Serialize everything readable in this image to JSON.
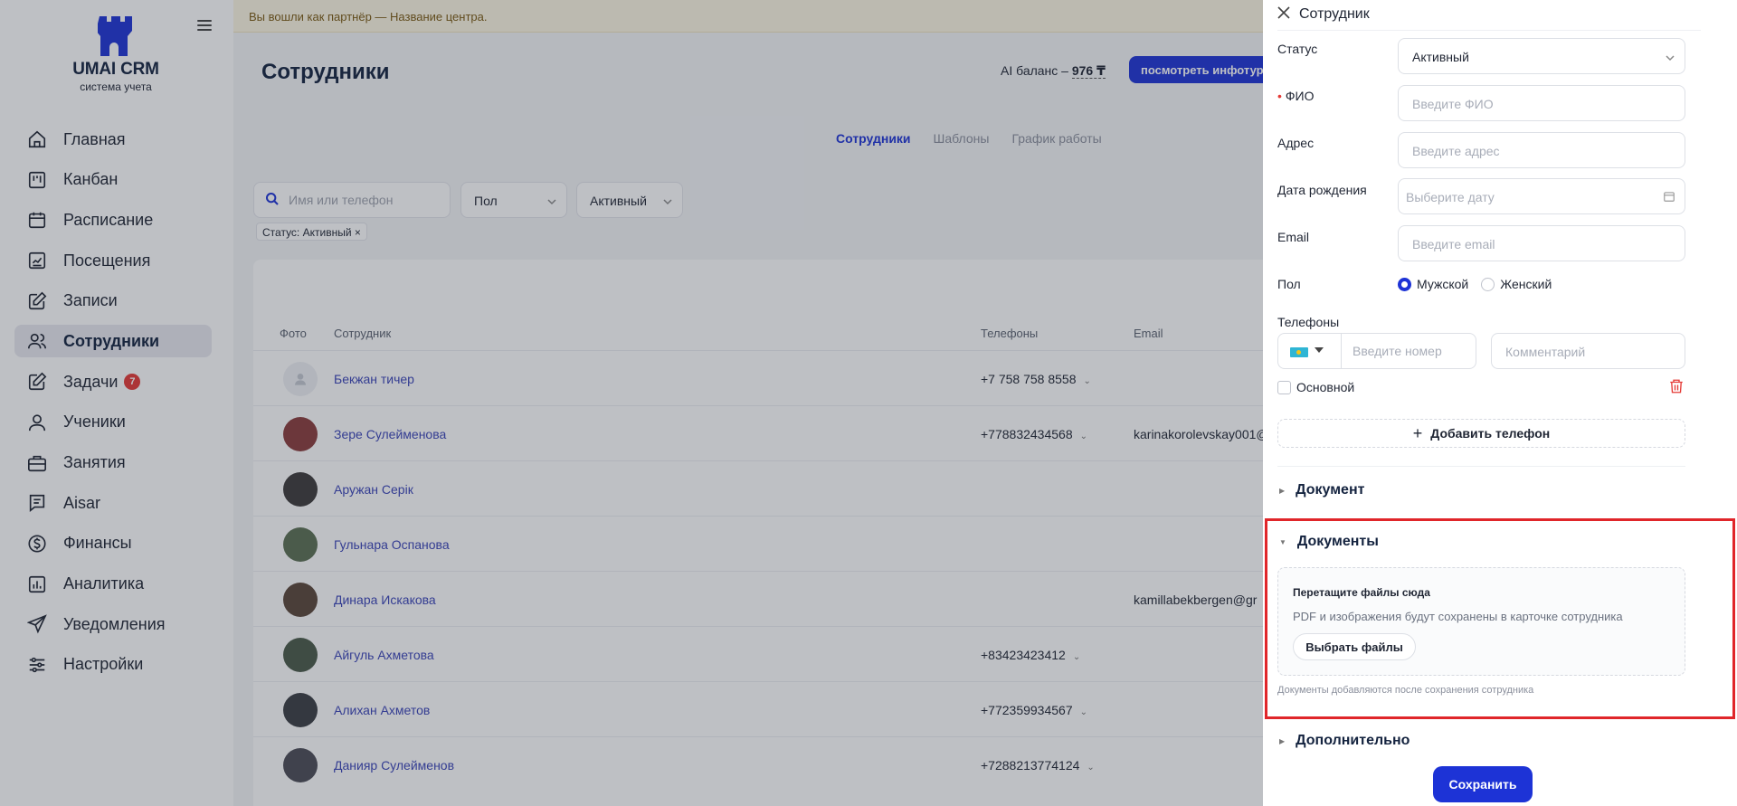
{
  "app": {
    "name": "UMAI CRM",
    "subtitle": "система учета"
  },
  "sidebar": {
    "items": [
      {
        "label": "Главная",
        "icon": "home-icon"
      },
      {
        "label": "Канбан",
        "icon": "kanban-icon"
      },
      {
        "label": "Расписание",
        "icon": "calendar-icon"
      },
      {
        "label": "Посещения",
        "icon": "chart-icon"
      },
      {
        "label": "Записи",
        "icon": "edit-icon"
      },
      {
        "label": "Сотрудники",
        "icon": "users-icon",
        "active": true
      },
      {
        "label": "Задачи",
        "icon": "tasks-icon",
        "badge": "7"
      },
      {
        "label": "Ученики",
        "icon": "user-icon"
      },
      {
        "label": "Занятия",
        "icon": "briefcase-icon"
      },
      {
        "label": "Aisar",
        "icon": "chat-icon"
      },
      {
        "label": "Финансы",
        "icon": "dollar-icon"
      },
      {
        "label": "Аналитика",
        "icon": "analytics-icon"
      },
      {
        "label": "Уведомления",
        "icon": "send-icon"
      },
      {
        "label": "Настройки",
        "icon": "settings-icon"
      }
    ]
  },
  "notice": "Вы вошли как партнёр — Название центра.",
  "header": {
    "title": "Сотрудники",
    "ai_balance_label": "AI баланс –",
    "ai_balance_value": "976 ₸",
    "info_button": "посмотреть инфотур"
  },
  "tabs": [
    "Сотрудники",
    "Шаблоны",
    "График работы"
  ],
  "filters": {
    "search_placeholder": "Имя или телефон",
    "gender": "Пол",
    "status": "Активный",
    "chip": "Статус: Активный ×"
  },
  "table": {
    "headers": {
      "photo": "Фото",
      "employee": "Сотрудник",
      "phones": "Телефоны",
      "email": "Email"
    },
    "rows": [
      {
        "name": "Бекжан тичер",
        "phone": "+7 758 758 8558",
        "email": "",
        "avatar_color": "#eef0f4"
      },
      {
        "name": "Зере Сулейменова",
        "phone": "+778832434568",
        "email": "karinakorolevskay001@",
        "avatar_color": "#8a3b3b"
      },
      {
        "name": "Аружан Серік",
        "phone": "",
        "email": "",
        "avatar_color": "#3d3a3a"
      },
      {
        "name": "Гульнара Оспанова",
        "phone": "",
        "email": "",
        "avatar_color": "#5b6f52"
      },
      {
        "name": "Динара Искакова",
        "phone": "",
        "email": "kamillabekbergen@gr",
        "avatar_color": "#5a4538"
      },
      {
        "name": "Айгуль Ахметова",
        "phone": "+83423423412",
        "email": "",
        "avatar_color": "#4a5a48"
      },
      {
        "name": "Алихан Ахметов",
        "phone": "+772359934567",
        "email": "",
        "avatar_color": "#3a3d42"
      },
      {
        "name": "Данияр Сулейменов",
        "phone": "+7288213774124",
        "email": "",
        "avatar_color": "#4b4b55"
      }
    ]
  },
  "drawer": {
    "title": "Сотрудник",
    "status_label": "Статус",
    "status_value": "Активный",
    "fio_label": "ФИО",
    "fio_placeholder": "Введите ФИО",
    "address_label": "Адрес",
    "address_placeholder": "Введите адрес",
    "birth_label": "Дата рождения",
    "birth_placeholder": "Выберите дату",
    "email_label": "Email",
    "email_placeholder": "Введите email",
    "gender_label": "Пол",
    "gender_male": "Мужской",
    "gender_female": "Женский",
    "phones_label": "Телефоны",
    "phone_placeholder": "Введите номер",
    "comment_placeholder": "Комментарий",
    "main_label": "Основной",
    "add_phone": "Добавить телефон",
    "section_document": "Документ",
    "section_documents": "Документы",
    "drop_title": "Перетащите файлы сюда",
    "drop_desc": "PDF и изображения будут сохранены в карточке сотрудника",
    "choose_files": "Выбрать файлы",
    "docs_note": "Документы добавляются после сохранения сотрудника",
    "section_additional": "Дополнительно",
    "save": "Сохранить"
  },
  "colors": {
    "accent": "#1d33d6",
    "highlight": "#e0262a",
    "badge": "#e53935"
  }
}
